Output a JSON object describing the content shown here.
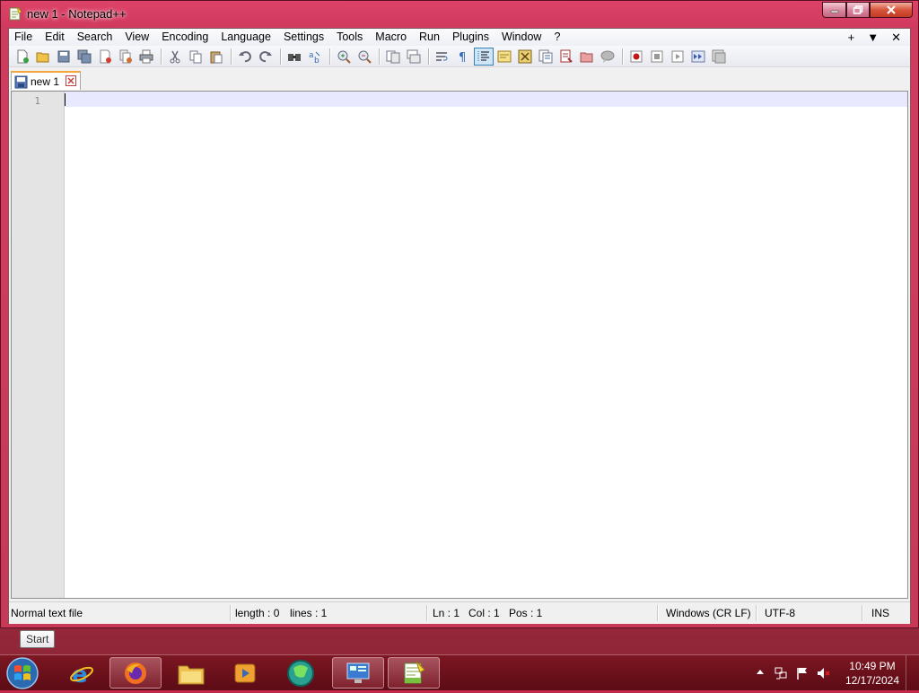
{
  "window": {
    "title": "new 1 - Notepad++"
  },
  "menubar": {
    "items": [
      "File",
      "Edit",
      "Search",
      "View",
      "Encoding",
      "Language",
      "Settings",
      "Tools",
      "Macro",
      "Run",
      "Plugins",
      "Window",
      "?"
    ],
    "right": [
      "+",
      "▼",
      "✕"
    ]
  },
  "toolbar": {
    "icons": [
      "new-file-icon",
      "open-file-icon",
      "save-icon",
      "save-all-icon",
      "close-icon",
      "close-all-icon",
      "print-icon",
      "cut-icon",
      "copy-icon",
      "paste-icon",
      "undo-icon",
      "redo-icon",
      "find-icon",
      "replace-icon",
      "zoom-in-icon",
      "zoom-out-icon",
      "sync-vertical-icon",
      "sync-horizontal-icon",
      "word-wrap-icon",
      "show-all-chars-icon",
      "indent-guide-icon",
      "user-language-icon",
      "doc-map-icon",
      "function-list-icon",
      "folder-workspace-icon",
      "monitoring-icon",
      "record-macro-icon",
      "stop-macro-icon",
      "play-macro-icon",
      "run-macro-multiple-icon",
      "save-macro-icon"
    ]
  },
  "tabs": [
    {
      "label": "new 1"
    }
  ],
  "editor": {
    "line_number": "1",
    "content": ""
  },
  "statusbar": {
    "file_type": "Normal text file",
    "length": "length : 0",
    "lines": "lines : 1",
    "ln": "Ln : 1",
    "col": "Col : 1",
    "pos": "Pos : 1",
    "eol": "Windows (CR LF)",
    "encoding": "UTF-8",
    "mode": "INS"
  },
  "tooltip": {
    "text": "Start"
  },
  "taskbar": {
    "apps": [
      "internet-explorer-icon",
      "firefox-icon",
      "file-explorer-icon",
      "media-player-icon",
      "browser-icon",
      "remote-desktop-icon",
      "notepadpp-icon"
    ],
    "time": "10:49 PM",
    "date": "12/17/2024"
  },
  "colors": {
    "tab_accent": "#f4a73d",
    "current_line": "#e8e8ff",
    "gutter": "#e4e4e4",
    "taskbar": "#7a1420"
  }
}
